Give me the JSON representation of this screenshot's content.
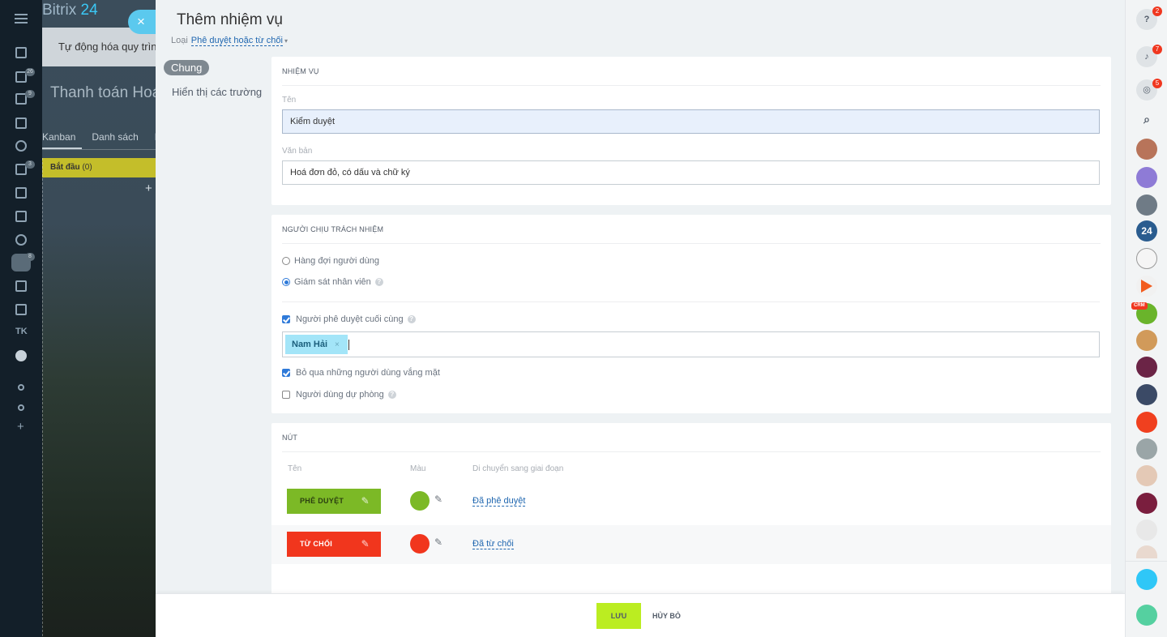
{
  "background": {
    "logo_name": "Bitrix",
    "logo_num": "24",
    "automation_label": "Tự động hóa quy trìn",
    "page_title": "Thanh toán Hoá",
    "tabs": [
      "Kanban",
      "Danh sách",
      "N"
    ],
    "stage_name": "Bắt đầu",
    "stage_count": "(0)",
    "add_symbol": "+",
    "close_symbol": "×"
  },
  "app_nav": {
    "counters": [
      "26",
      "9",
      "3",
      "8"
    ],
    "text_item": "TK",
    "plus": "+"
  },
  "panel": {
    "title": "Thêm nhiệm vụ",
    "type_label": "Loại",
    "type_value": "Phê duyệt hoặc từ chối",
    "menu": [
      "Chung",
      "Hiển thị các trường"
    ]
  },
  "task_section": {
    "heading": "NHIỆM VỤ",
    "name_label": "Tên",
    "name_value": "Kiểm duyệt",
    "text_label": "Văn bản",
    "text_value": "Hoá đơn đỏ, có dấu và chữ ký"
  },
  "responsible_section": {
    "heading": "NGƯỜI CHỊU TRÁCH NHIỆM",
    "radio_queue": "Hàng đợi người dùng",
    "radio_supervise": "Giám sát nhân viên",
    "final_approver": "Người phê duyệt cuối cùng",
    "selected_user": "Nam Hải",
    "remove_symbol": "×",
    "skip_absent": "Bỏ qua những người dùng vắng mặt",
    "backup_user": "Người dùng dự phòng",
    "help_symbol": "?"
  },
  "buttons_section": {
    "heading": "NÚT",
    "col_name": "Tên",
    "col_color": "Màu",
    "col_stage": "Di chuyển sang giai đoạn",
    "rows": [
      {
        "label": "PHÊ DUYỆT",
        "color": "#7cb926",
        "stage": "Đã phê duyệt"
      },
      {
        "label": "TỪ CHỐI",
        "color": "#f1361d",
        "stage": "Đã từ chối"
      }
    ]
  },
  "footer": {
    "save": "LƯU",
    "cancel": "HỦY BỎ"
  },
  "right_rail": {
    "badges": [
      "2",
      "7",
      "5"
    ],
    "crm_tag": "CRM",
    "number_avatar": "24",
    "icons": [
      "help-icon",
      "bell-icon",
      "chat-icon",
      "search-icon"
    ]
  }
}
